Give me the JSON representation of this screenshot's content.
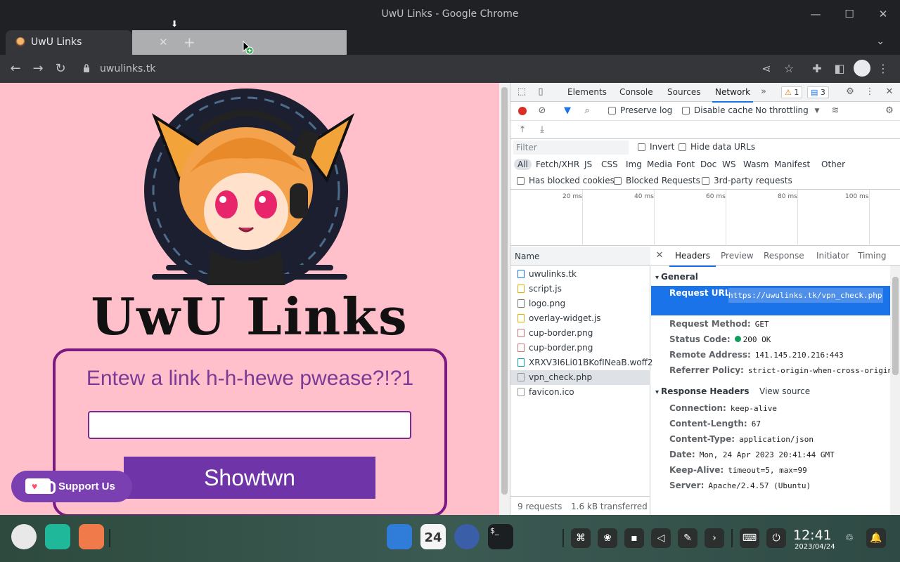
{
  "window": {
    "title": "UwU Links - Google Chrome"
  },
  "tab": {
    "label": "UwU Links"
  },
  "address_bar": {
    "url": "uwulinks.tk"
  },
  "page": {
    "brand": "UwU Links",
    "prompt": "Entew a link h-h-hewe pwease?!?1",
    "input_value": "",
    "submit_label": "Showtwn",
    "support_label": "Support Us"
  },
  "devtools": {
    "tabs": [
      "Elements",
      "Console",
      "Sources",
      "Network"
    ],
    "warnings": "1",
    "messages": "3",
    "preserve_log": "Preserve log",
    "disable_cache": "Disable cache",
    "throttling": "No throttling",
    "filter_placeholder": "Filter",
    "invert": "Invert",
    "hide_data_urls": "Hide data URLs",
    "types": [
      "All",
      "Fetch/XHR",
      "JS",
      "CSS",
      "Img",
      "Media",
      "Font",
      "Doc",
      "WS",
      "Wasm",
      "Manifest",
      "Other"
    ],
    "blocked_cookies": "Has blocked cookies",
    "blocked_requests": "Blocked Requests",
    "third_party": "3rd-party requests",
    "ticks": [
      "20 ms",
      "40 ms",
      "60 ms",
      "80 ms",
      "100 ms"
    ],
    "name_header": "Name",
    "requests": [
      "uwulinks.tk",
      "script.js",
      "logo.png",
      "overlay-widget.js",
      "cup-border.png",
      "cup-border.png",
      "XRXV3I6Li01BKofINeaB.woff2",
      "vpn_check.php",
      "favicon.ico"
    ],
    "summary_requests": "9 requests",
    "summary_transferred": "1.6 kB transferred",
    "detail_tabs": [
      "Headers",
      "Preview",
      "Response",
      "Initiator",
      "Timing"
    ],
    "general_title": "General",
    "general": {
      "request_url_key": "Request URL:",
      "request_url": "https://uwulinks.tk/vpn_check.php",
      "method_key": "Request Method:",
      "method": "GET",
      "status_key": "Status Code:",
      "status": "200 OK",
      "remote_key": "Remote Address:",
      "remote": "141.145.210.216:443",
      "referrer_key": "Referrer Policy:",
      "referrer": "strict-origin-when-cross-origin"
    },
    "response_title": "Response Headers",
    "view_source": "View source",
    "response_headers": [
      {
        "k": "Connection:",
        "v": "keep-alive"
      },
      {
        "k": "Content-Length:",
        "v": "67"
      },
      {
        "k": "Content-Type:",
        "v": "application/json"
      },
      {
        "k": "Date:",
        "v": "Mon, 24 Apr 2023 20:41:44 GMT"
      },
      {
        "k": "Keep-Alive:",
        "v": "timeout=5, max=99"
      },
      {
        "k": "Server:",
        "v": "Apache/2.4.57 (Ubuntu)"
      }
    ]
  },
  "taskbar": {
    "time": "12:41",
    "date": "2023/04/24",
    "calendar_day": "24"
  }
}
